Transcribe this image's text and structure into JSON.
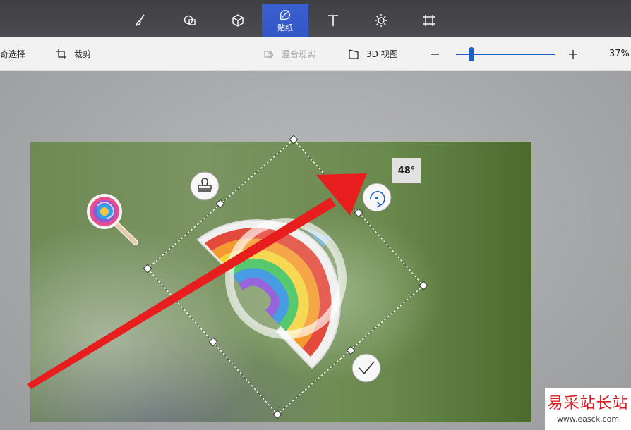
{
  "tools": [
    {
      "name": "brush-icon",
      "label": ""
    },
    {
      "name": "2d-shapes-icon",
      "label": ""
    },
    {
      "name": "3d-shapes-icon",
      "label": ""
    },
    {
      "name": "sticker-icon",
      "label": "贴纸",
      "active": true
    },
    {
      "name": "text-icon",
      "label": ""
    },
    {
      "name": "effects-icon",
      "label": ""
    },
    {
      "name": "canvas-icon",
      "label": ""
    }
  ],
  "toolbar": {
    "magic_select_label": "神奇选择",
    "crop_label": "裁剪",
    "mixed_reality_label": "混合现实",
    "view_3d_label": "3D 视图",
    "zoom_percent": "37%",
    "zoom_value": 37
  },
  "sticker": {
    "rotation_label": "48°"
  },
  "watermark": {
    "cn": "易采站长站",
    "url": "www.easck.com"
  },
  "colors": {
    "accent": "#3357c4",
    "annotation_arrow": "#e81e1e"
  }
}
